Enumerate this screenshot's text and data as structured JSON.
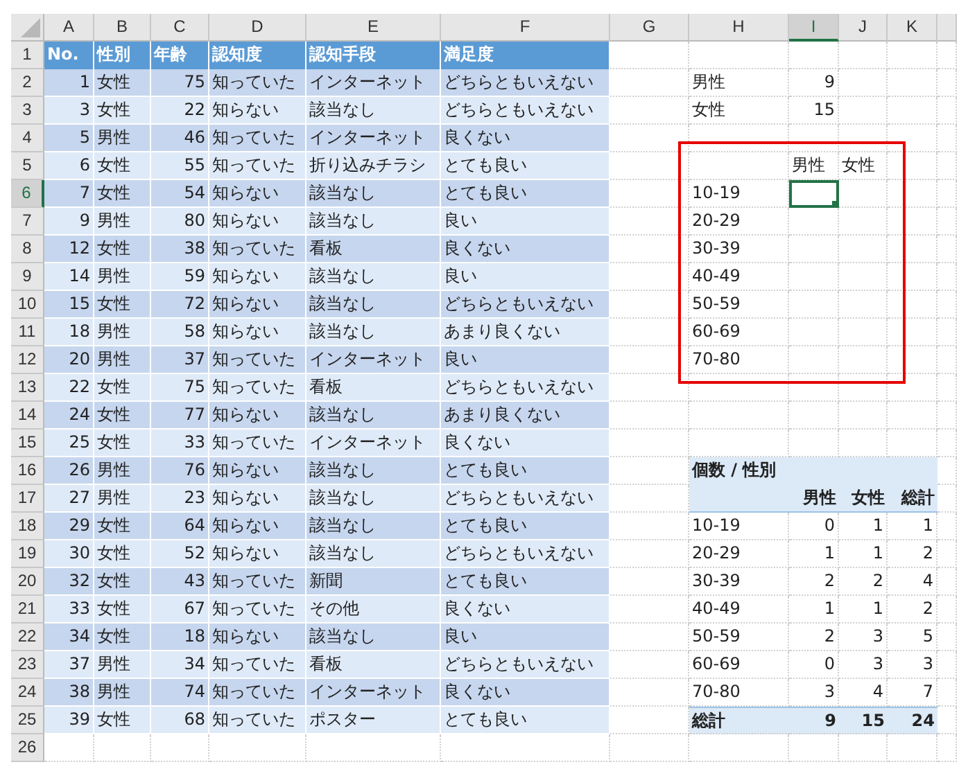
{
  "column_headers": [
    {
      "label": "A",
      "selected": false
    },
    {
      "label": "B",
      "selected": false
    },
    {
      "label": "C",
      "selected": false
    },
    {
      "label": "D",
      "selected": false
    },
    {
      "label": "E",
      "selected": false
    },
    {
      "label": "F",
      "selected": false
    },
    {
      "label": "G",
      "selected": false
    },
    {
      "label": "H",
      "selected": false
    },
    {
      "label": "I",
      "selected": true
    },
    {
      "label": "J",
      "selected": false
    },
    {
      "label": "K",
      "selected": false
    }
  ],
  "row_numbers": [
    {
      "label": "1",
      "selected": false
    },
    {
      "label": "2",
      "selected": false
    },
    {
      "label": "3",
      "selected": false
    },
    {
      "label": "4",
      "selected": false
    },
    {
      "label": "5",
      "selected": false
    },
    {
      "label": "6",
      "selected": true
    },
    {
      "label": "7",
      "selected": false
    },
    {
      "label": "8",
      "selected": false
    },
    {
      "label": "9",
      "selected": false
    },
    {
      "label": "10",
      "selected": false
    },
    {
      "label": "11",
      "selected": false
    },
    {
      "label": "12",
      "selected": false
    },
    {
      "label": "13",
      "selected": false
    },
    {
      "label": "14",
      "selected": false
    },
    {
      "label": "15",
      "selected": false
    },
    {
      "label": "16",
      "selected": false
    },
    {
      "label": "17",
      "selected": false
    },
    {
      "label": "18",
      "selected": false
    },
    {
      "label": "19",
      "selected": false
    },
    {
      "label": "20",
      "selected": false
    },
    {
      "label": "21",
      "selected": false
    },
    {
      "label": "22",
      "selected": false
    },
    {
      "label": "23",
      "selected": false
    },
    {
      "label": "24",
      "selected": false
    },
    {
      "label": "25",
      "selected": false
    },
    {
      "label": "26",
      "selected": false
    }
  ],
  "table": {
    "columns": [
      "No.",
      "性別",
      "年齢",
      "認知度",
      "認知手段",
      "満足度"
    ],
    "rows": [
      [
        "1",
        "女性",
        "75",
        "知っていた",
        "インターネット",
        "どちらともいえない"
      ],
      [
        "3",
        "女性",
        "22",
        "知らない",
        "該当なし",
        "どちらともいえない"
      ],
      [
        "5",
        "男性",
        "46",
        "知っていた",
        "インターネット",
        "良くない"
      ],
      [
        "6",
        "女性",
        "55",
        "知っていた",
        "折り込みチラシ",
        "とても良い"
      ],
      [
        "7",
        "女性",
        "54",
        "知らない",
        "該当なし",
        "とても良い"
      ],
      [
        "9",
        "男性",
        "80",
        "知らない",
        "該当なし",
        "良い"
      ],
      [
        "12",
        "女性",
        "38",
        "知っていた",
        "看板",
        "良くない"
      ],
      [
        "14",
        "男性",
        "59",
        "知らない",
        "該当なし",
        "良い"
      ],
      [
        "15",
        "女性",
        "72",
        "知らない",
        "該当なし",
        "どちらともいえない"
      ],
      [
        "18",
        "男性",
        "58",
        "知らない",
        "該当なし",
        "あまり良くない"
      ],
      [
        "20",
        "男性",
        "37",
        "知っていた",
        "インターネット",
        "良い"
      ],
      [
        "22",
        "女性",
        "75",
        "知っていた",
        "看板",
        "どちらともいえない"
      ],
      [
        "24",
        "女性",
        "77",
        "知らない",
        "該当なし",
        "あまり良くない"
      ],
      [
        "25",
        "女性",
        "33",
        "知っていた",
        "インターネット",
        "良くない"
      ],
      [
        "26",
        "男性",
        "76",
        "知らない",
        "該当なし",
        "とても良い"
      ],
      [
        "27",
        "男性",
        "23",
        "知らない",
        "該当なし",
        "どちらともいえない"
      ],
      [
        "29",
        "女性",
        "64",
        "知らない",
        "該当なし",
        "とても良い"
      ],
      [
        "30",
        "女性",
        "52",
        "知らない",
        "該当なし",
        "どちらともいえない"
      ],
      [
        "32",
        "女性",
        "43",
        "知っていた",
        "新聞",
        "とても良い"
      ],
      [
        "33",
        "女性",
        "67",
        "知っていた",
        "その他",
        "良くない"
      ],
      [
        "34",
        "女性",
        "18",
        "知らない",
        "該当なし",
        "良い"
      ],
      [
        "37",
        "男性",
        "34",
        "知っていた",
        "看板",
        "どちらともいえない"
      ],
      [
        "38",
        "男性",
        "74",
        "知っていた",
        "インターネット",
        "良くない"
      ],
      [
        "39",
        "女性",
        "68",
        "知っていた",
        "ポスター",
        "とても良い"
      ]
    ]
  },
  "gender_counts": [
    {
      "label": "男性",
      "value": "9"
    },
    {
      "label": "女性",
      "value": "15"
    }
  ],
  "range_box": {
    "columns": [
      "男性",
      "女性"
    ],
    "rows": [
      {
        "label": "10-19",
        "cells": [
          {
            "selected": true
          },
          {
            "selected": false
          }
        ]
      },
      {
        "label": "20-29",
        "cells": [
          {
            "selected": false
          },
          {
            "selected": false
          }
        ]
      },
      {
        "label": "30-39",
        "cells": [
          {
            "selected": false
          },
          {
            "selected": false
          }
        ]
      },
      {
        "label": "40-49",
        "cells": [
          {
            "selected": false
          },
          {
            "selected": false
          }
        ]
      },
      {
        "label": "50-59",
        "cells": [
          {
            "selected": false
          },
          {
            "selected": false
          }
        ]
      },
      {
        "label": "60-69",
        "cells": [
          {
            "selected": false
          },
          {
            "selected": false
          }
        ]
      },
      {
        "label": "70-80",
        "cells": [
          {
            "selected": false
          },
          {
            "selected": false
          }
        ]
      }
    ]
  },
  "pivot": {
    "title": "個数 / 性別",
    "columns": [
      "男性",
      "女性",
      "総計"
    ],
    "rows": [
      {
        "label": "10-19",
        "values": [
          "0",
          "1",
          "1"
        ]
      },
      {
        "label": "20-29",
        "values": [
          "1",
          "1",
          "2"
        ]
      },
      {
        "label": "30-39",
        "values": [
          "2",
          "2",
          "4"
        ]
      },
      {
        "label": "40-49",
        "values": [
          "1",
          "1",
          "2"
        ]
      },
      {
        "label": "50-59",
        "values": [
          "2",
          "3",
          "5"
        ]
      },
      {
        "label": "60-69",
        "values": [
          "0",
          "3",
          "3"
        ]
      },
      {
        "label": "70-80",
        "values": [
          "3",
          "4",
          "7"
        ]
      }
    ],
    "total": {
      "label": "総計",
      "values": [
        "9",
        "15",
        "24"
      ]
    }
  }
}
